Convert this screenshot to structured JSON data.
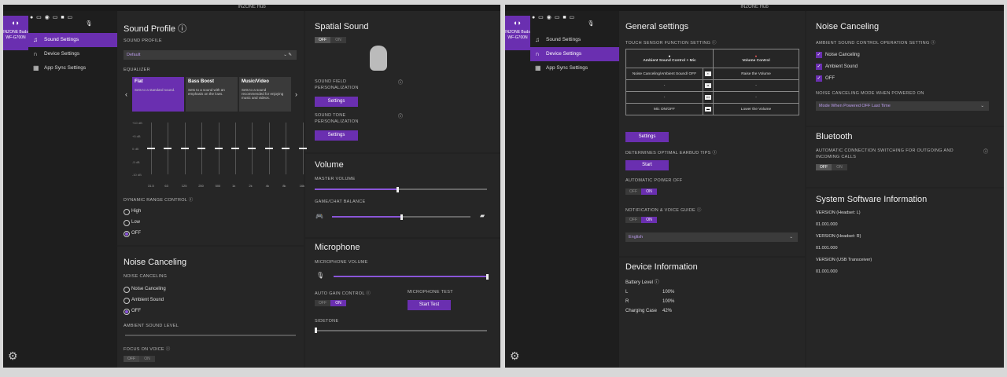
{
  "window1": {
    "title": "INZONE Hub",
    "device": {
      "name": "INZONE Buds",
      "model": "WF-G700N"
    },
    "nav": [
      {
        "label": "Sound Settings",
        "icon": "music-note-icon"
      },
      {
        "label": "Device Settings",
        "icon": "headphones-icon"
      },
      {
        "label": "App Sync Settings",
        "icon": "grid-icon"
      }
    ],
    "sound_profile": {
      "title": "Sound Profile",
      "label": "SOUND PROFILE",
      "selected": "Default",
      "eq_label": "EQUALIZER",
      "presets": [
        {
          "name": "Flat",
          "desc": "Sets to a standard sound."
        },
        {
          "name": "Bass Boost",
          "desc": "Sets to a sound with an emphasis on the lows."
        },
        {
          "name": "Music/Video",
          "desc": "Sets to a sound recommended for enjoying music and videos."
        }
      ],
      "eq_db": [
        "+10 dB",
        "+5 dB",
        "0 dB",
        "-5 dB",
        "-10 dB"
      ],
      "eq_freqs": [
        "31.5",
        "63",
        "125",
        "250",
        "500",
        "1k",
        "2k",
        "4k",
        "8k",
        "16k"
      ],
      "eq_values": [
        0,
        0,
        0,
        0,
        0,
        0,
        0,
        0,
        0,
        0
      ],
      "drc_label": "DYNAMIC RANGE CONTROL",
      "drc_options": [
        "High",
        "Low",
        "OFF"
      ],
      "drc_selected": "OFF"
    },
    "noise": {
      "title": "Noise Canceling",
      "label": "NOISE CANCELING",
      "options": [
        "Noise Canceling",
        "Ambient Sound",
        "OFF"
      ],
      "selected": "OFF",
      "ambient_level": "AMBIENT SOUND LEVEL",
      "focus_voice": "FOCUS ON VOICE",
      "toggle_off": "OFF",
      "toggle_on": "ON"
    },
    "spatial": {
      "title": "Spatial Sound",
      "toggle_off": "OFF",
      "toggle_on": "ON",
      "field_label": "SOUND FIELD PERSONALIZATION",
      "tone_label": "SOUND TONE PERSONALIZATION",
      "settings_btn": "Settings"
    },
    "volume": {
      "title": "Volume",
      "master_label": "MASTER VOLUME",
      "master_value": 0.48,
      "balance_label": "GAME/CHAT BALANCE",
      "balance_value": 0.5
    },
    "mic": {
      "title": "Microphone",
      "volume_label": "MICROPHONE VOLUME",
      "volume_value": 1.0,
      "agc_label": "AUTO GAIN CONTROL",
      "test_label": "MICROPHONE TEST",
      "test_btn": "Start Test",
      "sidetone_label": "SIDETONE",
      "toggle_off": "OFF",
      "toggle_on": "ON"
    }
  },
  "window2": {
    "title": "INZONE Hub",
    "general": {
      "title": "General settings",
      "touch_label": "TOUCH SENSOR FUNCTION SETTING",
      "col1": "Ambient Sound Control + Mic",
      "col2": "Volume Control",
      "rows": [
        {
          "left": "Noise Canceling/Ambient Sound/ OFF",
          "right": "Raise the Volume"
        },
        {
          "left": "-",
          "right": "-"
        },
        {
          "left": "-",
          "right": "-"
        },
        {
          "left": "Mic ON/OFF",
          "right": "Lower the Volume"
        }
      ],
      "settings_btn": "Settings",
      "tips_label": "DETERMINES OPTIMAL EARBUD TIPS",
      "start_btn": "Start",
      "auto_power_label": "AUTOMATIC POWER OFF",
      "notif_label": "NOTIFICATION & VOICE GUIDE",
      "language": "English",
      "toggle_off": "OFF",
      "toggle_on": "ON"
    },
    "device_info": {
      "title": "Device Information",
      "battery_label": "Battery Level",
      "l_label": "L",
      "l_value": "100%",
      "r_label": "R",
      "r_value": "100%",
      "case_label": "Charging Case",
      "case_value": "42%"
    },
    "nc": {
      "title": "Noise Canceling",
      "op_label": "AMBIENT SOUND CONTROL OPERATION SETTING",
      "checks": [
        "Noise Canceling",
        "Ambient Sound",
        "OFF"
      ],
      "mode_label": "NOISE CANCELING MODE WHEN POWERED ON",
      "mode_value": "Mode When Powered OFF Last Time"
    },
    "bluetooth": {
      "title": "Bluetooth",
      "auto_label": "AUTOMATIC CONNECTION SWITCHING FOR OUTGOING AND INCOMING CALLS",
      "toggle_off": "OFF",
      "toggle_on": "ON"
    },
    "system": {
      "title": "System Software Information",
      "entries": [
        {
          "label": "VERSION (Headset: L)",
          "value": "01.001.000"
        },
        {
          "label": "VERSION (Headset: R)",
          "value": "01.001.000"
        },
        {
          "label": "VERSION (USB Transceiver)",
          "value": "01.001.000"
        }
      ]
    }
  }
}
